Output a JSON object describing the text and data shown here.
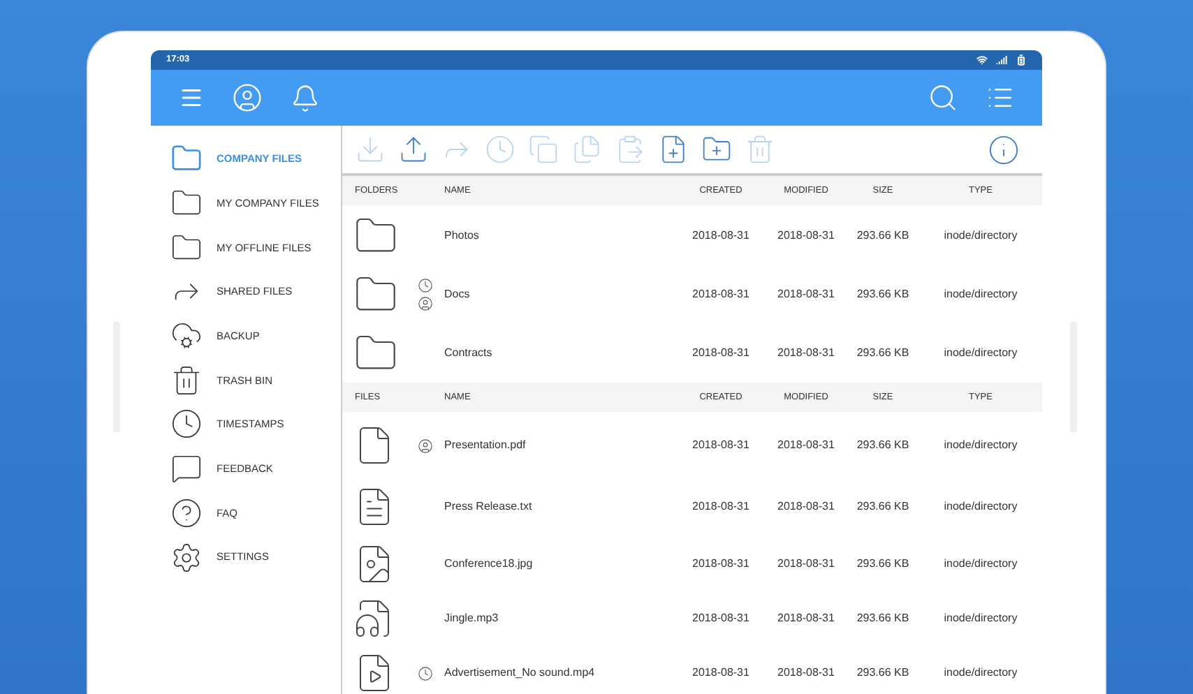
{
  "status_bar": {
    "time": "17:03"
  },
  "sidebar": {
    "items": [
      {
        "label": "COMPANY FILES",
        "kind": "folder",
        "selected": true
      },
      {
        "label": "MY COMPANY FILES",
        "kind": "folder",
        "selected": false
      },
      {
        "label": "MY OFFLINE FILES",
        "kind": "folder",
        "selected": false
      },
      {
        "label": "SHARED FILES",
        "kind": "shared",
        "selected": false
      },
      {
        "label": "BACKUP",
        "kind": "backup",
        "selected": false
      },
      {
        "label": "TRASH BIN",
        "kind": "trash",
        "selected": false
      },
      {
        "label": "TIMESTAMPS",
        "kind": "timestamp",
        "selected": false
      },
      {
        "label": "FEEDBACK",
        "kind": "feedback",
        "selected": false
      },
      {
        "label": "FAQ",
        "kind": "faq",
        "selected": false
      },
      {
        "label": "SETTINGS",
        "kind": "settings",
        "selected": false
      }
    ]
  },
  "toolbar": [
    {
      "kind": "download",
      "disabled": true
    },
    {
      "kind": "upload",
      "disabled": false
    },
    {
      "kind": "share",
      "disabled": true
    },
    {
      "kind": "timestamp",
      "disabled": true
    },
    {
      "kind": "copy",
      "disabled": true
    },
    {
      "kind": "move",
      "disabled": true
    },
    {
      "kind": "paste",
      "disabled": true
    },
    {
      "kind": "new-file",
      "disabled": false
    },
    {
      "kind": "new-folder",
      "disabled": false
    },
    {
      "kind": "delete",
      "disabled": true
    }
  ],
  "folders": {
    "columns": [
      "FOLDERS",
      "NAME",
      "CREATED",
      "MODIFIED",
      "SIZE",
      "TYPE"
    ],
    "rows": [
      {
        "kind": "folder",
        "name": "Photos",
        "created": "2018-08-31",
        "modified": "2018-08-31",
        "size": "293.66 KB",
        "type": "inode/directory",
        "timestamped": false,
        "shared": false
      },
      {
        "kind": "folder",
        "name": "Docs",
        "created": "2018-08-31",
        "modified": "2018-08-31",
        "size": "293.66 KB",
        "type": "inode/directory",
        "timestamped": true,
        "shared": true
      },
      {
        "kind": "folder",
        "name": "Contracts",
        "created": "2018-08-31",
        "modified": "2018-08-31",
        "size": "293.66 KB",
        "type": "inode/directory",
        "timestamped": false,
        "shared": false
      }
    ]
  },
  "files": {
    "columns": [
      "FILES",
      "NAME",
      "CREATED",
      "MODIFIED",
      "SIZE",
      "TYPE"
    ],
    "rows": [
      {
        "kind": "pdf",
        "name": "Presentation.pdf",
        "created": "2018-08-31",
        "modified": "2018-08-31",
        "size": "293.66 KB",
        "type": "inode/directory",
        "timestamped": false,
        "shared": true
      },
      {
        "kind": "text",
        "name": "Press Release.txt",
        "created": "2018-08-31",
        "modified": "2018-08-31",
        "size": "293.66 KB",
        "type": "inode/directory",
        "timestamped": false,
        "shared": false
      },
      {
        "kind": "image",
        "name": "Conference18.jpg",
        "created": "2018-08-31",
        "modified": "2018-08-31",
        "size": "293.66 KB",
        "type": "inode/directory",
        "timestamped": false,
        "shared": false
      },
      {
        "kind": "audio",
        "name": "Jingle.mp3",
        "created": "2018-08-31",
        "modified": "2018-08-31",
        "size": "293.66 KB",
        "type": "inode/directory",
        "timestamped": false,
        "shared": false
      },
      {
        "kind": "video",
        "name": "Advertisement_No sound.mp4",
        "created": "2018-08-31",
        "modified": "2018-08-31",
        "size": "293.66 KB",
        "type": "inode/directory",
        "timestamped": true,
        "shared": false
      }
    ]
  }
}
